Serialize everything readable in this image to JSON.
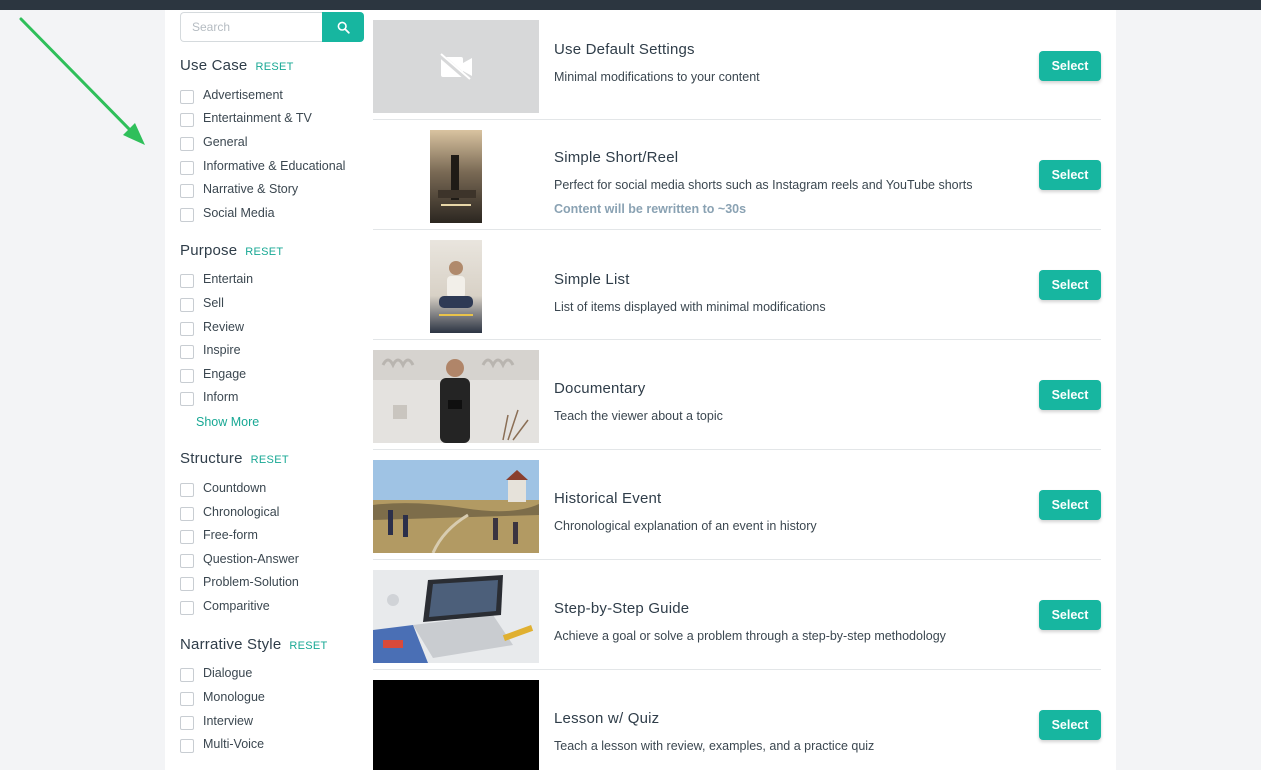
{
  "search": {
    "placeholder": "Search"
  },
  "filters": [
    {
      "title": "Use Case",
      "reset": "RESET",
      "options": [
        "Advertisement",
        "Entertainment & TV",
        "General",
        "Informative & Educational",
        "Narrative & Story",
        "Social Media"
      ]
    },
    {
      "title": "Purpose",
      "reset": "RESET",
      "options": [
        "Entertain",
        "Sell",
        "Review",
        "Inspire",
        "Engage",
        "Inform"
      ],
      "show_more": "Show More"
    },
    {
      "title": "Structure",
      "reset": "RESET",
      "options": [
        "Countdown",
        "Chronological",
        "Free-form",
        "Question-Answer",
        "Problem-Solution",
        "Comparitive"
      ]
    },
    {
      "title": "Narrative Style",
      "reset": "RESET",
      "options": [
        "Dialogue",
        "Monologue",
        "Interview",
        "Multi-Voice"
      ]
    }
  ],
  "templates": [
    {
      "title": "Use Default Settings",
      "desc": "Minimal modifications to your content",
      "button": "Select"
    },
    {
      "title": "Simple Short/Reel",
      "desc": "Perfect for social media shorts such as Instagram reels and YouTube shorts",
      "note": "Content will be rewritten to ~30s",
      "button": "Select"
    },
    {
      "title": "Simple List",
      "desc": "List of items displayed with minimal modifications",
      "button": "Select"
    },
    {
      "title": "Documentary",
      "desc": "Teach the viewer about a topic",
      "button": "Select"
    },
    {
      "title": "Historical Event",
      "desc": "Chronological explanation of an event in history",
      "button": "Select"
    },
    {
      "title": "Step-by-Step Guide",
      "desc": "Achieve a goal or solve a problem through a step-by-step methodology",
      "button": "Select"
    },
    {
      "title": "Lesson w/ Quiz",
      "desc": "Teach a lesson with review, examples, and a practice quiz",
      "button": "Select"
    }
  ],
  "colors": {
    "accent": "#17b6a0",
    "arrow": "#2fbf5a",
    "topbar": "#2c3640"
  }
}
